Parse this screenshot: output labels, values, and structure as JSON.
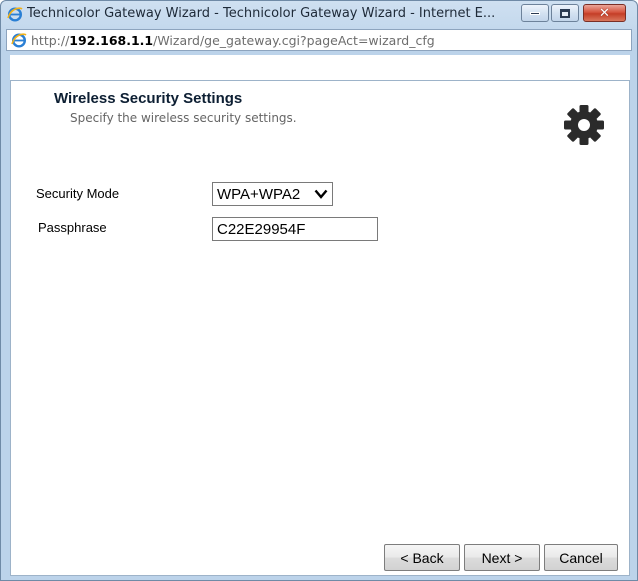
{
  "window": {
    "title": "Technicolor Gateway Wizard - Technicolor Gateway Wizard - Internet E...",
    "icon": "ie-icon"
  },
  "address": {
    "prefix": "http://",
    "host": "192.168.1.1",
    "path": "/Wizard/ge_gateway.cgi?pageAct=wizard_cfg"
  },
  "page": {
    "title": "Wireless Security Settings",
    "subtitle": "Specify the wireless security settings.",
    "icon": "gear-icon"
  },
  "form": {
    "security_mode_label": "Security Mode",
    "security_mode_value": "WPA+WPA2",
    "passphrase_label": "Passphrase",
    "passphrase_value": "C22E29954F"
  },
  "buttons": {
    "back": "< Back",
    "next": "Next >",
    "cancel": "Cancel"
  },
  "colors": {
    "frame": "#bcd3ea",
    "close_button": "#c43e27",
    "title_text": "#0d1f33"
  }
}
